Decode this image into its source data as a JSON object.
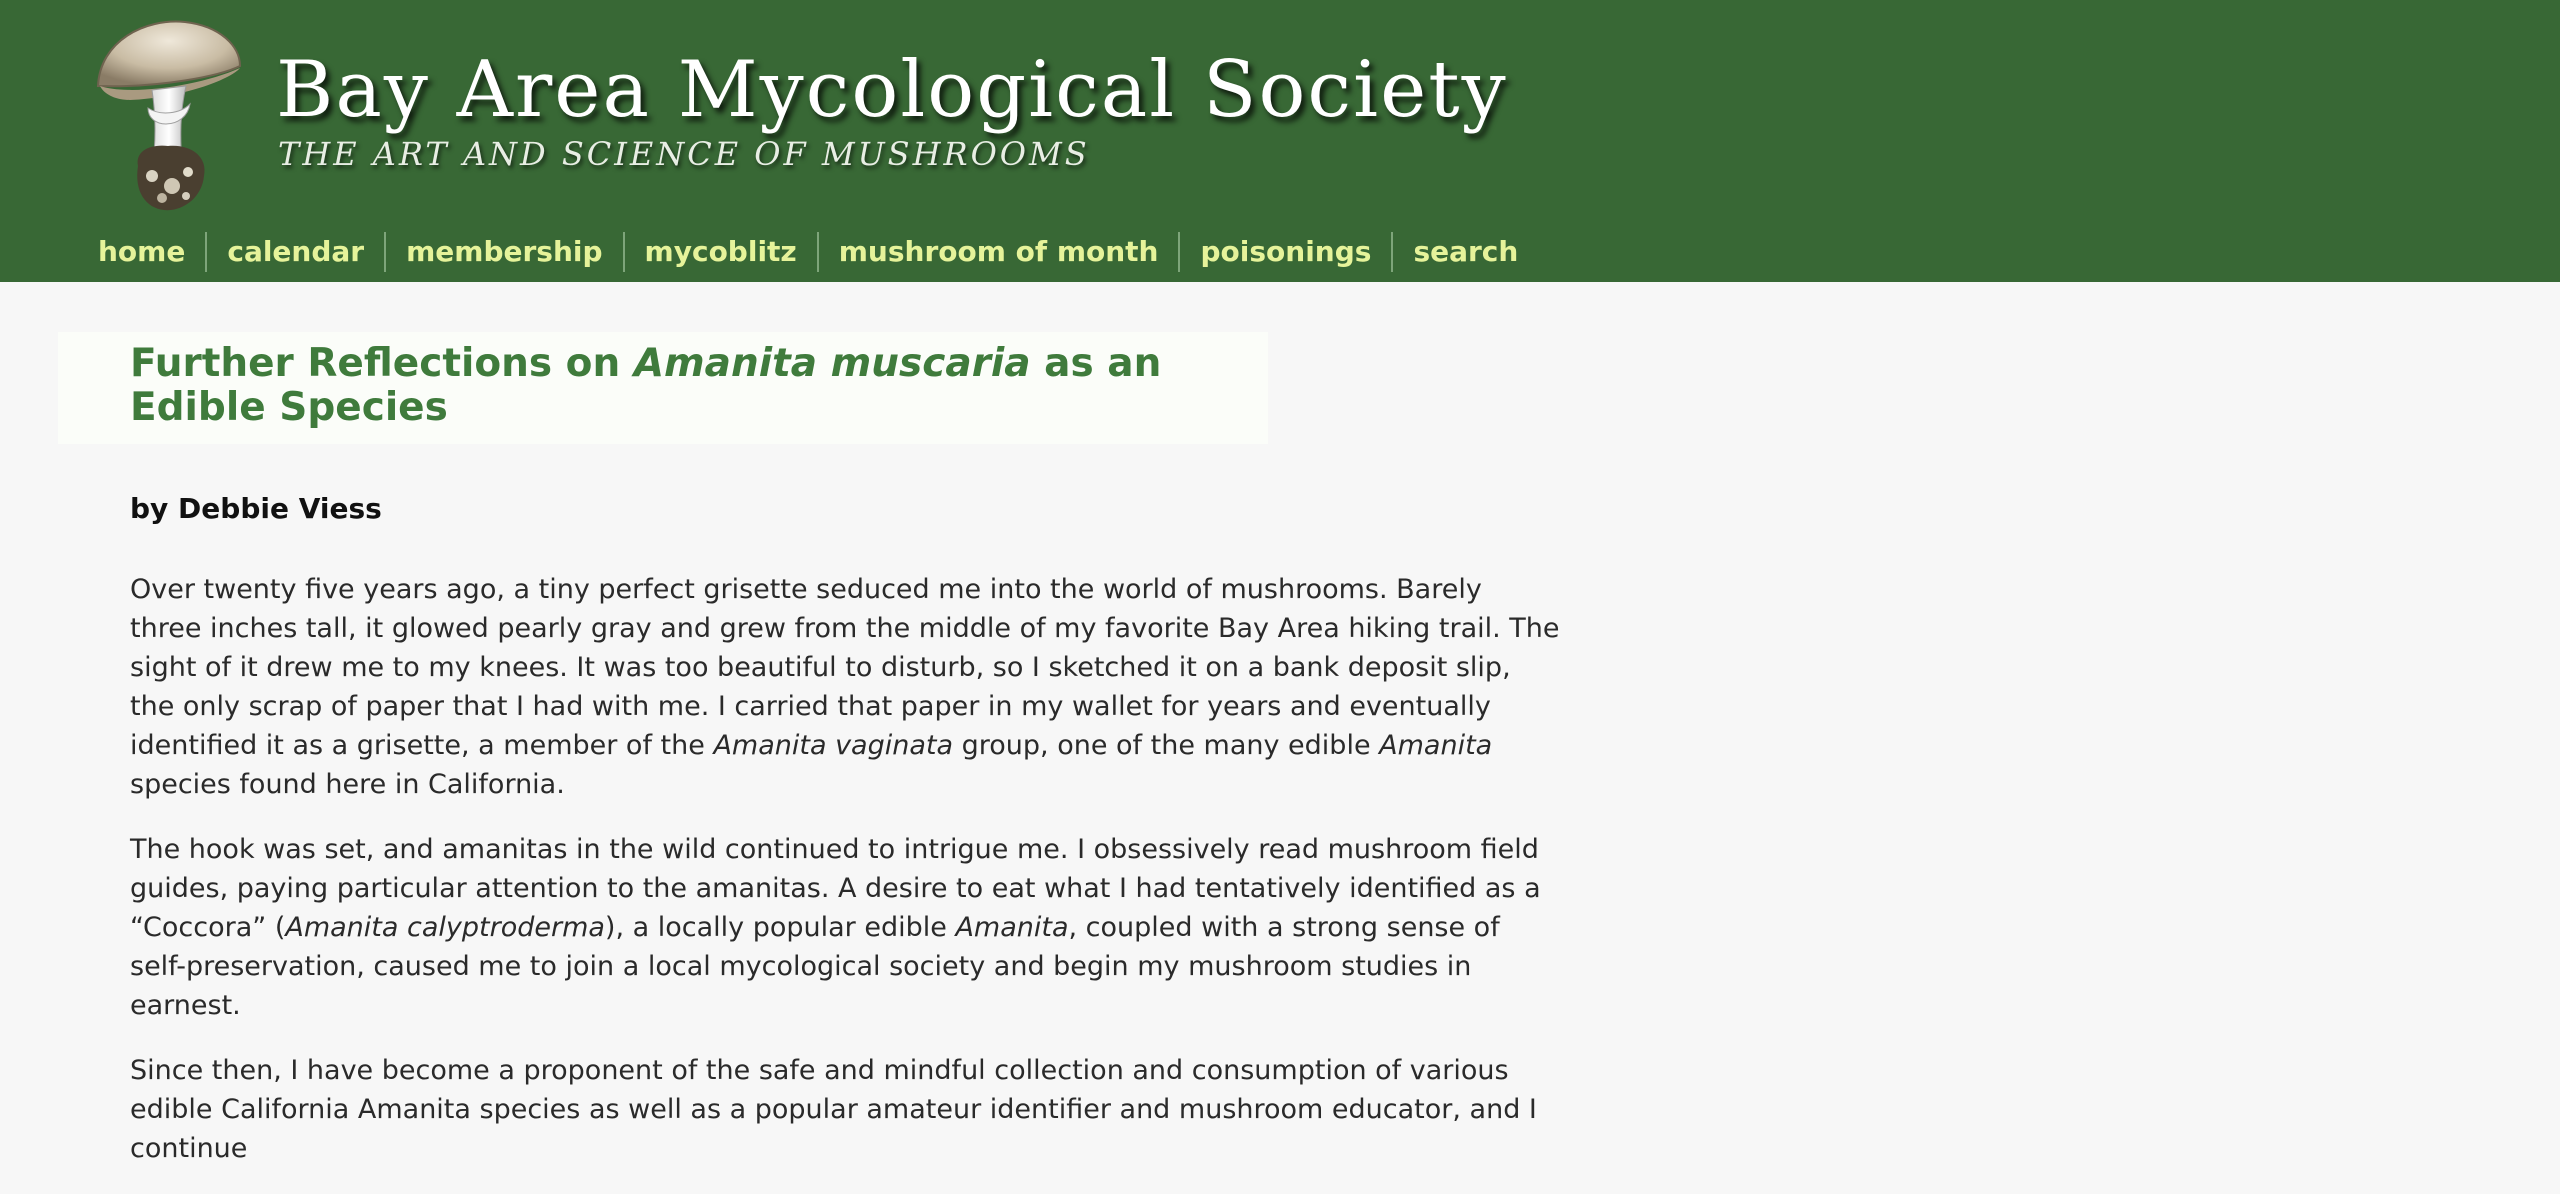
{
  "header": {
    "site_title": "Bay Area Mycological Society",
    "tagline": "THE ART AND SCIENCE OF MUSHROOMS",
    "logo_icon": "mushroom-icon",
    "background_color": "#386835"
  },
  "nav": {
    "items": [
      "home",
      "calendar",
      "membership",
      "mycoblitz",
      "mushroom of month",
      "poisonings",
      "search"
    ],
    "link_color": "#e6f39a"
  },
  "article": {
    "title_part1": "Further Reflections on ",
    "title_italic": "Amanita muscaria",
    "title_part2": " as an Edible Species",
    "title_color": "#3f7b3c",
    "byline": "by Debbie Viess",
    "p1": {
      "a": "Over twenty five years ago, a tiny perfect grisette seduced me into the world of mushrooms. Barely three inches tall, it glowed pearly gray and grew from the middle of my favorite Bay Area hiking trail. The sight of it drew me to my knees. It was too beautiful to disturb, so I sketched it on a bank deposit slip, the only scrap of paper that I had with me. I carried that paper in my wallet for years and eventually identified it as a grisette, a member of the ",
      "i1": "Amanita vaginata",
      "b": " group, one of the many edible ",
      "i2": "Amanita",
      "c": " species found here in California."
    },
    "p2": {
      "a": "The hook was set, and amanitas in the wild continued to intrigue me. I obsessively read mushroom field guides, paying particular attention to the amanitas. A desire to eat what I had tentatively identified as a “Coccora” (",
      "i1": "Amanita calyptroderma",
      "b": "), a locally popular edible ",
      "i2": "Amanita",
      "c": ", coupled with a strong sense of self-preservation, caused me to join a local mycological society and begin my mushroom studies in earnest."
    },
    "p3": {
      "a": "Since then, I have become a proponent of the safe and mindful collection and consumption of various edible California Amanita species as well as a popular amateur identifier and mushroom educator, and I continue"
    }
  }
}
